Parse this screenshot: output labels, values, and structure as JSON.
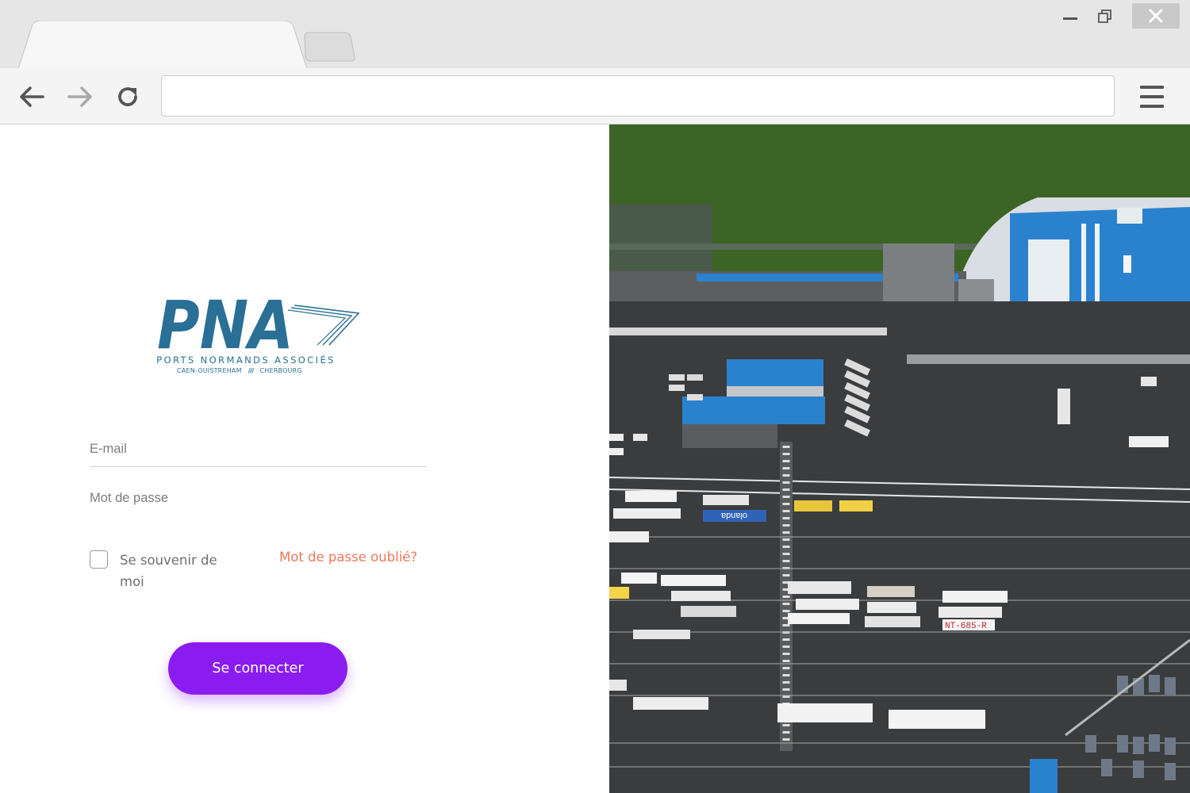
{
  "browser": {
    "address_value": "",
    "tabs": [
      {
        "label": ""
      },
      {
        "label": ""
      }
    ]
  },
  "logo": {
    "mark": "PNA",
    "name": "PORTS NORMANDS ASSOCIÉS",
    "city_left": "CAEN-OUISTREHAM",
    "city_sep": "////",
    "city_right": "CHERBOURG"
  },
  "login": {
    "email_placeholder": "E-mail",
    "password_placeholder": "Mot de passe",
    "remember_label": "Se souvenir de moi",
    "forgot_label": "Mot de passe oublié?",
    "submit_label": "Se connecter"
  },
  "hero_image": {
    "truck_plate": "NT-685-R",
    "truck_brand": "olanda",
    "colors": {
      "water": "#3b6425",
      "ship_deck": "#2a82cf",
      "asphalt": "#3b3c3e"
    }
  },
  "colors": {
    "accent": "#8b1cf0",
    "link": "#f0775a",
    "logo": "#2a6f95"
  }
}
